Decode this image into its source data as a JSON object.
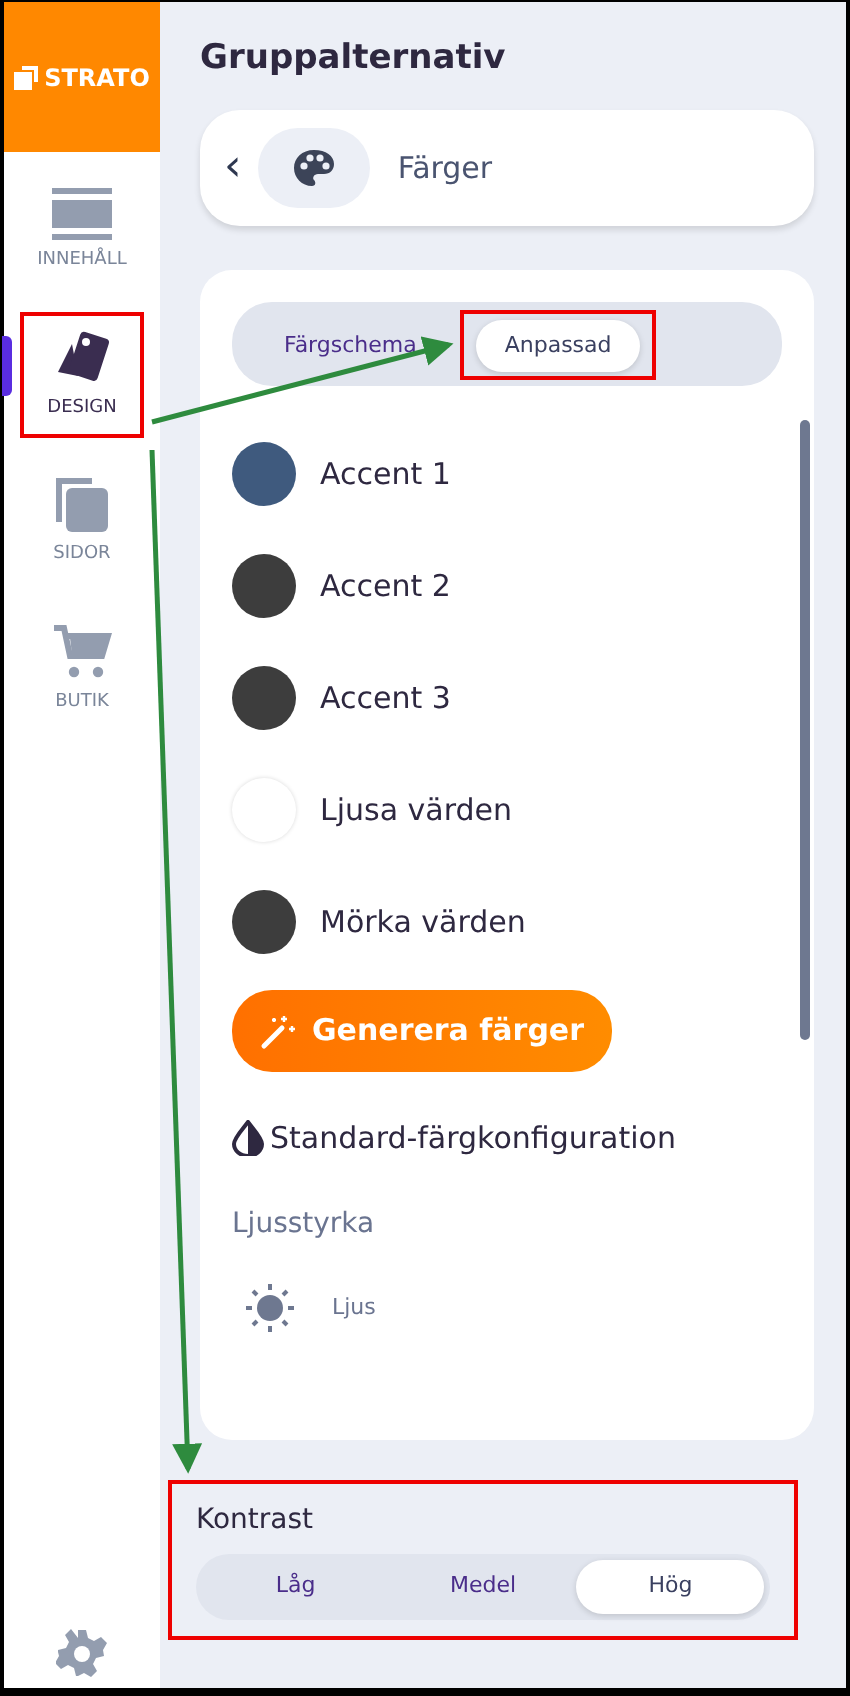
{
  "logo": {
    "text": "STRATO"
  },
  "nav": [
    {
      "label": "INNEHÅLL",
      "selected": false,
      "highlighted": false
    },
    {
      "label": "DESIGN",
      "selected": true,
      "highlighted": true
    },
    {
      "label": "SIDOR",
      "selected": false,
      "highlighted": false
    },
    {
      "label": "BUTIK",
      "selected": false,
      "highlighted": false
    }
  ],
  "title": "Gruppalternativ",
  "header": {
    "back": "‹",
    "label": "Färger"
  },
  "scheme_tabs": [
    {
      "label": "Färgschema",
      "selected": false,
      "highlighted": false
    },
    {
      "label": "Anpassad",
      "selected": true,
      "highlighted": true
    }
  ],
  "colors": [
    {
      "label": "Accent 1",
      "color": "#3f5a7e"
    },
    {
      "label": "Accent 2",
      "color": "#3d3d3d"
    },
    {
      "label": "Accent 3",
      "color": "#3d3d3d"
    },
    {
      "label": "Ljusa värden",
      "color": "#ffffff"
    },
    {
      "label": "Mörka värden",
      "color": "#3d3d3d"
    }
  ],
  "generate_button": "Generera färger",
  "default_config": "Standard-färgkonfiguration",
  "brightness": {
    "heading": "Ljusstyrka",
    "option": "Ljus"
  },
  "contrast": {
    "heading": "Kontrast",
    "highlighted": true,
    "options": [
      {
        "label": "Låg",
        "selected": false
      },
      {
        "label": "Medel",
        "selected": false
      },
      {
        "label": "Hög",
        "selected": true
      }
    ]
  }
}
